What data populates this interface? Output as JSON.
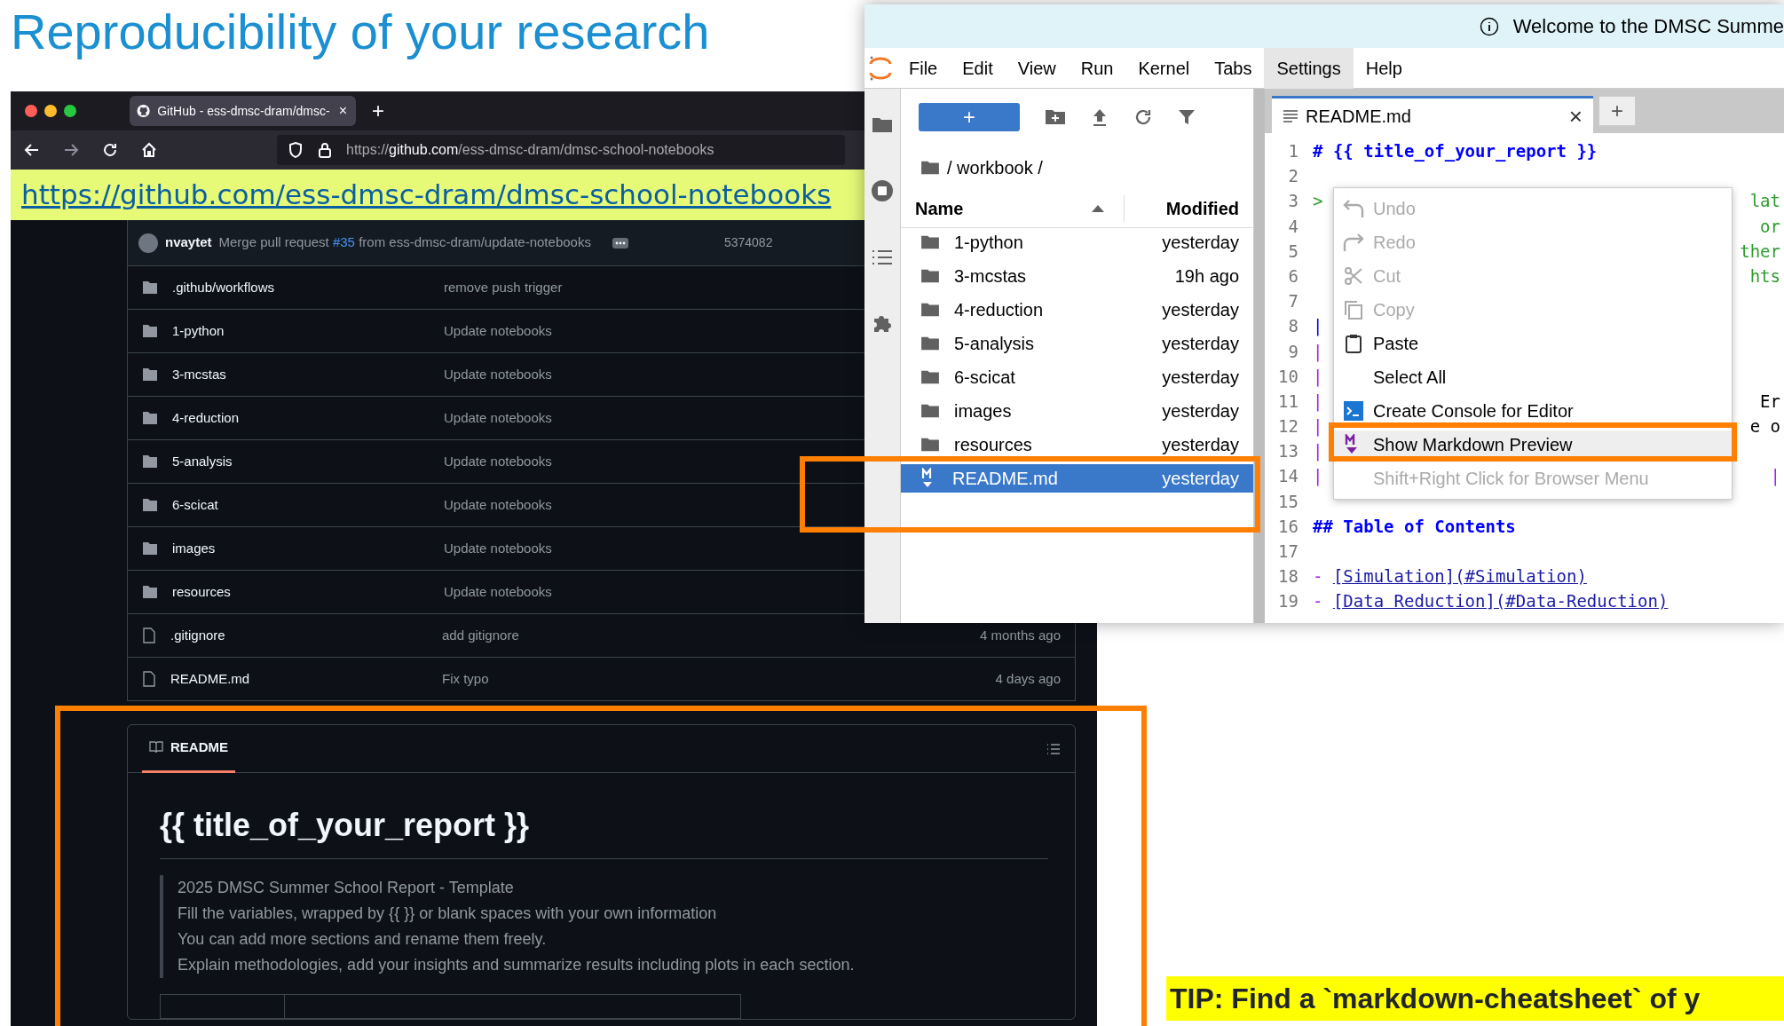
{
  "slide_title": "Reproducibility of your research",
  "browser": {
    "tab_title": "GitHub - ess-dmsc-dram/dmsc-",
    "tab_close": "×",
    "new_tab": "+",
    "url_scheme": "https://",
    "url_host": "github.com",
    "url_path": "/ess-dmsc-dram/dmsc-school-notebooks",
    "banner_link": "https://github.com/ess-dmsc-dram/dmsc-school-notebooks",
    "commit": {
      "author": "nvaytet",
      "message_start": "Merge pull request",
      "pr": "#35",
      "message_end": "from ess-dmsc-dram/update-notebooks",
      "hash": "5374082"
    },
    "files": [
      {
        "kind": "folder",
        "name": ".github/workflows",
        "message": "remove push trigger"
      },
      {
        "kind": "folder",
        "name": "1-python",
        "message": "Update notebooks"
      },
      {
        "kind": "folder",
        "name": "3-mcstas",
        "message": "Update notebooks"
      },
      {
        "kind": "folder",
        "name": "4-reduction",
        "message": "Update notebooks"
      },
      {
        "kind": "folder",
        "name": "5-analysis",
        "message": "Update notebooks"
      },
      {
        "kind": "folder",
        "name": "6-scicat",
        "message": "Update notebooks"
      },
      {
        "kind": "folder",
        "name": "images",
        "message": "Update notebooks"
      },
      {
        "kind": "folder",
        "name": "resources",
        "message": "Update notebooks"
      },
      {
        "kind": "file",
        "name": ".gitignore",
        "message": "add gitignore",
        "date": "4 months ago"
      },
      {
        "kind": "file",
        "name": "README.md",
        "message": "Fix typo",
        "date": "4 days ago"
      }
    ],
    "readme": {
      "tab": "README",
      "selected": true,
      "heading": "{{ title_of_your_report }}",
      "quote": [
        "2025 DMSC Summer School Report - Template",
        "Fill the variables, wrapped by {{ }} or blank spaces with your own information",
        "You can add more sections and rename them freely.",
        "Explain methodologies, add your insights and summarize results including plots in each section."
      ]
    }
  },
  "jupyter": {
    "notice": "Welcome to the DMSC Summe",
    "menu": [
      {
        "label": "File",
        "selected": false
      },
      {
        "label": "Edit",
        "selected": false
      },
      {
        "label": "View",
        "selected": false
      },
      {
        "label": "Run",
        "selected": false
      },
      {
        "label": "Kernel",
        "selected": false
      },
      {
        "label": "Tabs",
        "selected": false
      },
      {
        "label": "Settings",
        "selected": true
      },
      {
        "label": "Help",
        "selected": false
      }
    ],
    "launcher": "+",
    "breadcrumb": "/ workbook /",
    "columns": [
      "Name",
      "Modified"
    ],
    "files": [
      {
        "kind": "folder",
        "name": "1-python",
        "modified": "yesterday",
        "selected": false
      },
      {
        "kind": "folder",
        "name": "3-mcstas",
        "modified": "19h ago",
        "selected": false
      },
      {
        "kind": "folder",
        "name": "4-reduction",
        "modified": "yesterday",
        "selected": false
      },
      {
        "kind": "folder",
        "name": "5-analysis",
        "modified": "yesterday",
        "selected": false
      },
      {
        "kind": "folder",
        "name": "6-scicat",
        "modified": "yesterday",
        "selected": false
      },
      {
        "kind": "folder",
        "name": "images",
        "modified": "yesterday",
        "selected": false
      },
      {
        "kind": "folder",
        "name": "resources",
        "modified": "yesterday",
        "selected": false
      },
      {
        "kind": "markdown",
        "name": "README.md",
        "modified": "yesterday",
        "selected": true
      }
    ],
    "tab": {
      "title": "README.md",
      "close": "×",
      "selected": true
    },
    "new_tab": "+",
    "lines": [
      {
        "number": "1",
        "kind": "heading",
        "text": "# {{ title_of_your_report }}"
      },
      {
        "number": "2",
        "kind": "plain"
      },
      {
        "number": "3",
        "kind": "quote",
        "text": ">",
        "tail": "lat"
      },
      {
        "number": "4",
        "kind": "quote",
        "tail": "or"
      },
      {
        "number": "5",
        "kind": "quote",
        "tail": "ther"
      },
      {
        "number": "6",
        "kind": "quote",
        "tail": "hts"
      },
      {
        "number": "7",
        "kind": "plain"
      },
      {
        "number": "8",
        "kind": "table_header",
        "text": "|"
      },
      {
        "number": "9",
        "kind": "table",
        "text": "|"
      },
      {
        "number": "10",
        "kind": "table",
        "text": "|"
      },
      {
        "number": "11",
        "kind": "table",
        "text": "|",
        "tail": "Er"
      },
      {
        "number": "12",
        "kind": "table",
        "text": "|",
        "tail": "e o"
      },
      {
        "number": "13",
        "kind": "table",
        "text": "|"
      },
      {
        "number": "14",
        "kind": "table",
        "text": "|",
        "tail": "|"
      },
      {
        "number": "15",
        "kind": "plain"
      },
      {
        "number": "16",
        "kind": "heading",
        "text": "## Table of Contents"
      },
      {
        "number": "17",
        "kind": "plain"
      },
      {
        "number": "18",
        "kind": "list",
        "bullet": "-",
        "text": "[Simulation](#Simulation)"
      },
      {
        "number": "19",
        "kind": "list",
        "bullet": "-",
        "text": "[Data Reduction](#Data-Reduction)"
      }
    ],
    "context_menu": [
      {
        "label": "Undo",
        "disabled": true,
        "selected": false
      },
      {
        "label": "Redo",
        "disabled": true,
        "selected": false
      },
      {
        "label": "Cut",
        "disabled": true,
        "selected": false
      },
      {
        "label": "Copy",
        "disabled": true,
        "selected": false
      },
      {
        "label": "Paste",
        "disabled": false,
        "selected": false
      },
      {
        "label": "Select All",
        "disabled": false,
        "selected": false
      },
      {
        "label": "Create Console for Editor",
        "disabled": false,
        "selected": false
      },
      {
        "label": "Show Markdown Preview",
        "disabled": false,
        "selected": true
      },
      {
        "label": "Shift+Right Click for Browser Menu",
        "disabled": true,
        "selected": false
      }
    ]
  },
  "tip": "TIP: Find a `markdown-cheatsheet` of y"
}
